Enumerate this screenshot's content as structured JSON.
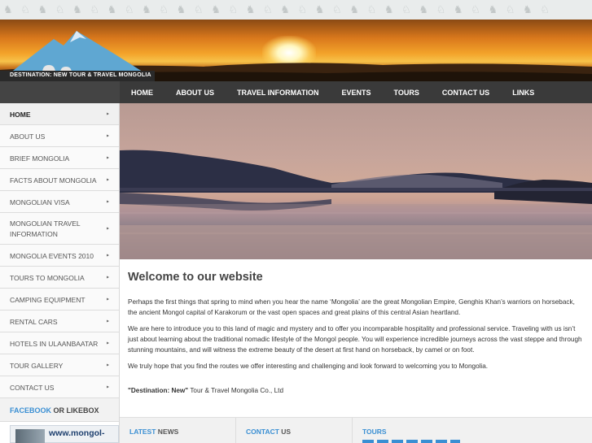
{
  "banner": {
    "tagline": "DESTINATION: NEW TOUR & TRAVEL MONGOLIA"
  },
  "topnav": {
    "items": [
      "HOME",
      "ABOUT US",
      "TRAVEL INFORMATION",
      "EVENTS",
      "TOURS",
      "CONTACT US",
      "LINKS"
    ]
  },
  "sidebar": {
    "items": [
      {
        "label": "HOME"
      },
      {
        "label": "ABOUT US"
      },
      {
        "label": "BRIEF MONGOLIA"
      },
      {
        "label": "FACTS ABOUT MONGOLIA"
      },
      {
        "label": "MONGOLIAN VISA"
      },
      {
        "label": "MONGOLIAN TRAVEL INFORMATION"
      },
      {
        "label": "MONGOLIA EVENTS 2010"
      },
      {
        "label": "TOURS TO MONGOLIA"
      },
      {
        "label": "CAMPING EQUIPMENT"
      },
      {
        "label": "RENTAL CARS"
      },
      {
        "label": "HOTELS IN ULAANBAATAR"
      },
      {
        "label": "TOUR GALLERY"
      },
      {
        "label": "CONTACT US"
      }
    ],
    "arrow": "▸",
    "facebook_highlight": "FACEBOOK",
    "facebook_rest": " OR LIKEBOX",
    "banner_url": "www.mongol-"
  },
  "content": {
    "heading": "Welcome to our website",
    "paragraphs": [
      "Perhaps the first things that spring to mind when you hear the name ‘Mongolia’ are the great Mongolian Empire, Genghis Khan’s warriors on horseback, the ancient Mongol capital of Karakorum or the vast open spaces and great plains of this central Asian heartland.",
      "We are here to introduce you to this land of magic and mystery and to offer you incomparable hospitality and professional service. Traveling with us isn’t just about learning about the traditional nomadic lifestyle of the Mongol people. You will experience incredible journeys across the vast steppe and through stunning mountains, and will witness the extreme beauty of the desert at first hand on horseback, by camel or on foot.",
      "We truly hope that you find the routes we offer interesting and challenging and look forward to welcoming you to Mongolia."
    ],
    "signature_bold": "\"Destination: New\"",
    "signature_rest": " Tour & Travel Mongolia Co., Ltd"
  },
  "bottom": {
    "latest_hl": "LATEST",
    "latest_rest": " NEWS",
    "contact_hl": "CONTACT",
    "contact_rest": " US",
    "tours_hl": "TOURS",
    "tours_rest": ""
  },
  "colors": {
    "nav_bg": "#3a3a3a",
    "accent": "#3a8fd3"
  }
}
